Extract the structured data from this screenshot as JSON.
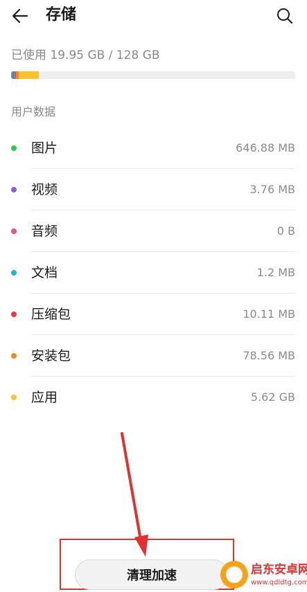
{
  "header": {
    "title": "存储"
  },
  "usage": {
    "text": "已使用 19.95 GB / 128 GB",
    "segments": [
      {
        "category": "图片",
        "color": "#2bc94a",
        "fraction": 0.006
      },
      {
        "category": "视频",
        "color": "#8e5ae0",
        "fraction": 0.004
      },
      {
        "category": "音频",
        "color": "#e8508a",
        "fraction": 0.002
      },
      {
        "category": "文档",
        "color": "#1fb4d8",
        "fraction": 0.002
      },
      {
        "category": "压缩包",
        "color": "#ea3a3a",
        "fraction": 0.004
      },
      {
        "category": "安装包",
        "color": "#f08a1c",
        "fraction": 0.01
      },
      {
        "category": "应用",
        "color": "#f9c12e",
        "fraction": 0.07
      }
    ]
  },
  "section": {
    "label": "用户数据"
  },
  "items": [
    {
      "label": "图片",
      "value": "646.88 MB",
      "color": "#2bc94a"
    },
    {
      "label": "视频",
      "value": "3.76 MB",
      "color": "#8e5ae0"
    },
    {
      "label": "音频",
      "value": "0 B",
      "color": "#e8508a"
    },
    {
      "label": "文档",
      "value": "1.2 MB",
      "color": "#1fb4d8"
    },
    {
      "label": "压缩包",
      "value": "10.11 MB",
      "color": "#ea3a3a"
    },
    {
      "label": "安装包",
      "value": "78.56 MB",
      "color": "#f08a1c"
    },
    {
      "label": "应用",
      "value": "5.62 GB",
      "color": "#f9c12e"
    }
  ],
  "footer": {
    "clean_button": "清理加速"
  },
  "annotation": {
    "color": "#e03030"
  },
  "watermark": {
    "title": "启东安卓网",
    "url": "www.qdldtg.com"
  }
}
